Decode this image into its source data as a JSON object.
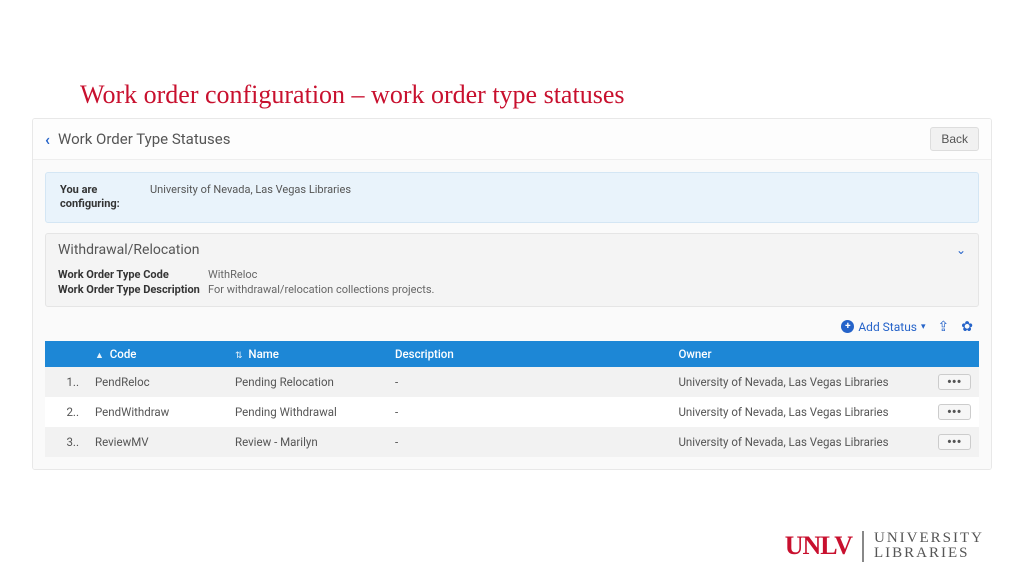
{
  "slide": {
    "title": "Work order configuration – work order type statuses"
  },
  "header": {
    "page_title": "Work Order Type Statuses",
    "back_chevron": "‹",
    "back_button": "Back"
  },
  "banner": {
    "label": "You are configuring:",
    "value": "University of Nevada, Las Vegas Libraries"
  },
  "type_panel": {
    "title": "Withdrawal/Relocation",
    "collapse_glyph": "⌄",
    "rows": {
      "code_label": "Work Order Type Code",
      "code_value": "WithReloc",
      "desc_label": "Work Order Type Description",
      "desc_value": "For withdrawal/relocation collections projects."
    }
  },
  "actions": {
    "add_status_label": "Add Status",
    "plus_glyph": "+",
    "caret_glyph": "▾",
    "export_glyph": "⇪",
    "gear_glyph": "✿"
  },
  "table": {
    "headers": {
      "idx": "",
      "code": "Code",
      "name": "Name",
      "description": "Description",
      "owner": "Owner",
      "actions": ""
    },
    "sort_asc_glyph": "▲",
    "sort_both_glyph": "⇅",
    "rows": [
      {
        "idx": "1..",
        "code": "PendReloc",
        "name": "Pending Relocation",
        "description": "-",
        "owner": "University of Nevada, Las Vegas Libraries",
        "act": "•••"
      },
      {
        "idx": "2..",
        "code": "PendWithdraw",
        "name": "Pending Withdrawal",
        "description": "-",
        "owner": "University of Nevada, Las Vegas Libraries",
        "act": "•••"
      },
      {
        "idx": "3..",
        "code": "ReviewMV",
        "name": "Review - Marilyn",
        "description": "-",
        "owner": "University of Nevada, Las Vegas Libraries",
        "act": "•••"
      }
    ]
  },
  "footer": {
    "mark": "UNLV",
    "line1": "UNIVERSITY",
    "line2": "LIBRARIES"
  }
}
